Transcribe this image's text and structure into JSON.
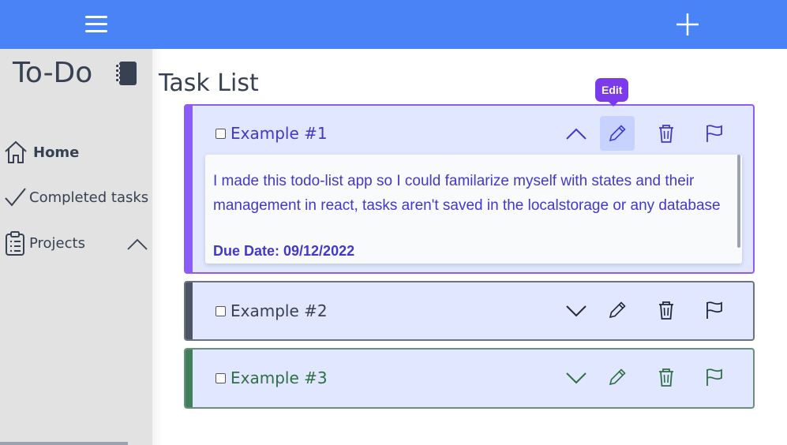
{
  "app": {
    "title": "To-Do"
  },
  "topbar": {
    "menu_icon": "hamburger-menu-icon",
    "add_icon": "plus-icon",
    "color": "#4a83f6"
  },
  "sidebar": {
    "items": [
      {
        "label": "Home",
        "icon": "home-icon"
      },
      {
        "label": "Completed tasks",
        "icon": "checkmark-icon"
      },
      {
        "label": "Projects",
        "icon": "clipboard-icon"
      }
    ],
    "projects_expanded": true
  },
  "main": {
    "title": "Task List",
    "tooltip": "Edit",
    "tasks": [
      {
        "name": "Example #1",
        "expanded": true,
        "description": "I made this todo-list app so I could familarize myself with states and their management in react, tasks aren't saved in the localstorage or any database",
        "due_date": "Due Date: 09/12/2022",
        "color": "#8b5cf6"
      },
      {
        "name": "Example #2",
        "expanded": false,
        "color": "#4b5563"
      },
      {
        "name": "Example #3",
        "expanded": false,
        "color": "#3f7f5a"
      }
    ]
  }
}
